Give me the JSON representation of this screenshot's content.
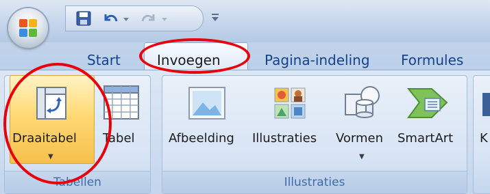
{
  "tabs": {
    "start": "Start",
    "invoegen": "Invoegen",
    "pagina_indeling": "Pagina-indeling",
    "formules": "Formules"
  },
  "groups": {
    "tabellen": {
      "label": "Tabellen",
      "buttons": [
        {
          "label": "Draaitabel",
          "has_dropdown": true,
          "icon": "pivot-table-icon",
          "highlighted": true
        },
        {
          "label": "Tabel",
          "has_dropdown": false,
          "icon": "table-icon"
        }
      ]
    },
    "illustraties": {
      "label": "Illustraties",
      "buttons": [
        {
          "label": "Afbeelding",
          "icon": "picture-icon"
        },
        {
          "label": "Illustraties",
          "icon": "clipart-icon"
        },
        {
          "label": "Vormen",
          "has_dropdown": true,
          "icon": "shapes-icon"
        },
        {
          "label": "SmartArt",
          "icon": "smartart-icon"
        }
      ]
    },
    "next_partial_label": "K"
  },
  "colors": {
    "tab_text": "#15428b",
    "group_label": "#3e6aaa",
    "highlight": "#ffd975",
    "annotation_red": "#e8000b"
  }
}
